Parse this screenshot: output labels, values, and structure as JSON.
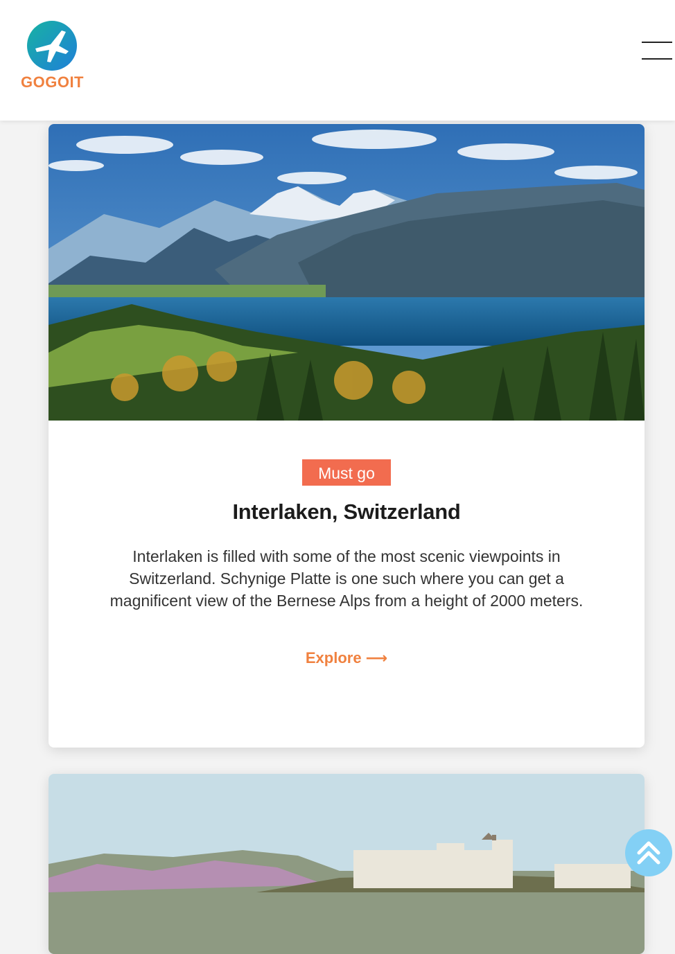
{
  "header": {
    "logo_text": "GOGOIT",
    "menu_icon": "hamburger-menu-icon"
  },
  "cards": [
    {
      "image_icon": "mountain-lake-photo",
      "badge": "Must go",
      "title": "Interlaken, Switzerland",
      "description": "Interlaken is filled with some of the most scenic viewpoints in Switzerland. Schynige Platte is one such where you can get a magnificent view of the Bernese Alps from a height of 2000 meters.",
      "link_label": "Explore",
      "link_icon": "arrow-right-icon"
    },
    {
      "image_icon": "castle-hill-photo"
    }
  ],
  "scroll_top_icon": "double-chevron-up-icon",
  "colors": {
    "accent": "#f0813f",
    "badge": "#f26c4f",
    "scroll_button": "#83d0f5",
    "logo_blue": "#1f8fd6",
    "logo_teal": "#18b2a3"
  }
}
